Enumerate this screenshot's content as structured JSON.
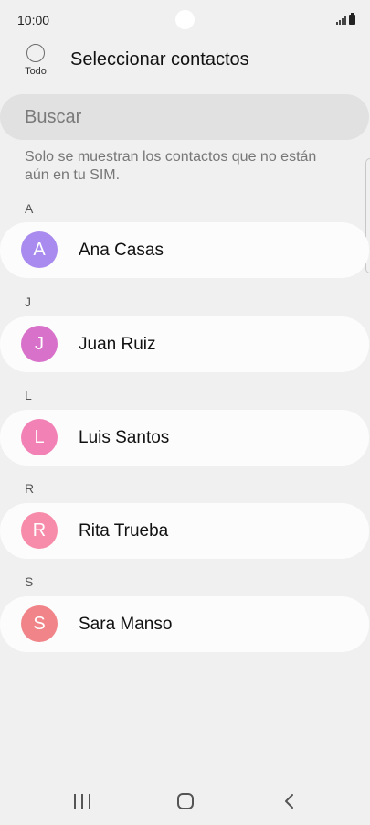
{
  "status_bar": {
    "time": "10:00"
  },
  "header": {
    "select_all_label": "Todo",
    "title": "Seleccionar contactos"
  },
  "search": {
    "placeholder": "Buscar"
  },
  "info_text": "Solo se muestran los contactos que no están aún en tu SIM.",
  "sections": [
    {
      "letter": "A",
      "contact": {
        "initial": "A",
        "name": "Ana Casas",
        "avatar_color": "#a98bef"
      }
    },
    {
      "letter": "J",
      "contact": {
        "initial": "J",
        "name": "Juan Ruiz",
        "avatar_color": "#d871c9"
      }
    },
    {
      "letter": "L",
      "contact": {
        "initial": "L",
        "name": "Luis Santos",
        "avatar_color": "#f282b6"
      }
    },
    {
      "letter": "R",
      "contact": {
        "initial": "R",
        "name": "Rita Trueba",
        "avatar_color": "#f78caa"
      }
    },
    {
      "letter": "S",
      "contact": {
        "initial": "S",
        "name": "Sara Manso",
        "avatar_color": "#f08488"
      }
    }
  ],
  "nav_bar": {
    "recents_icon": "recent-apps-icon",
    "home_icon": "home-icon",
    "back_icon": "back-icon"
  }
}
